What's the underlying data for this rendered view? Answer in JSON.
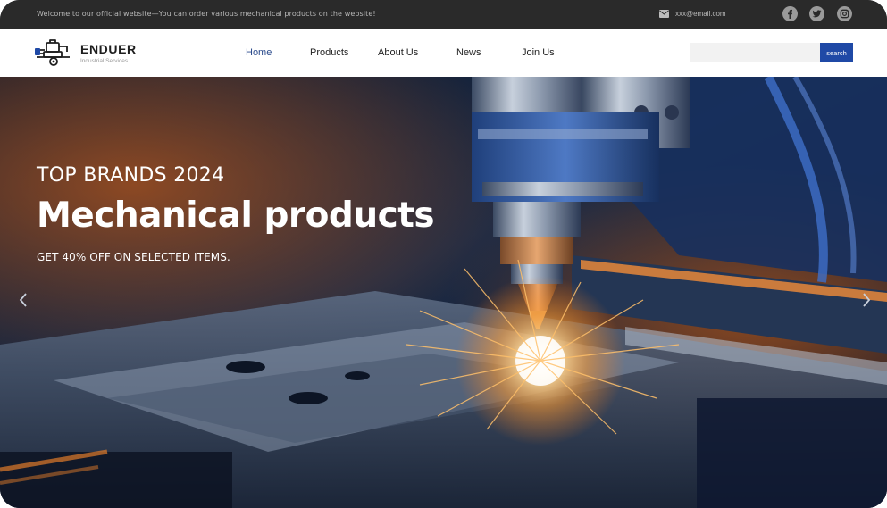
{
  "topbar": {
    "welcome_text": "Welcome to our official website—You can order various mechanical products on the website!",
    "email": "xxx@email.com",
    "mail_icon": "envelope-icon",
    "social_icons": [
      "facebook-icon",
      "twitter-icon",
      "instagram-icon"
    ]
  },
  "brand": {
    "name": "ENDUER",
    "subtitle": "Industrial Services",
    "logo_icon": "machine-logo-icon"
  },
  "nav": {
    "items": [
      {
        "label": "Home",
        "active": true
      },
      {
        "label": "Products",
        "active": false
      },
      {
        "label": "About Us",
        "active": false
      },
      {
        "label": "News",
        "active": false
      },
      {
        "label": "Join Us",
        "active": false
      }
    ]
  },
  "search": {
    "value": "",
    "placeholder": "",
    "button_label": "search"
  },
  "hero": {
    "kicker": "TOP BRANDS 2024",
    "title": "Mechanical products",
    "offer": "GET 40% OFF ON SELECTED ITEMS.",
    "prev_icon": "chevron-left-icon",
    "next_icon": "chevron-right-icon",
    "image": "laser-cutting-machine-sparks"
  },
  "colors": {
    "topbar_bg": "#2a2a2a",
    "accent_blue": "#1f49a6",
    "active_nav": "#2b4b8c",
    "hero_text": "#ffffff"
  }
}
